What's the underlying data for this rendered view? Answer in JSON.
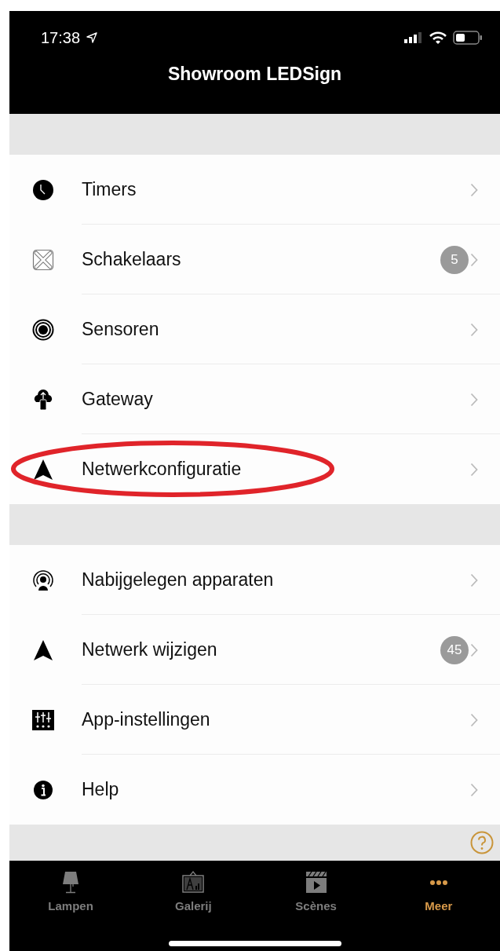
{
  "status_bar": {
    "time": "17:38"
  },
  "header": {
    "title": "Showroom LEDSign"
  },
  "sections": [
    {
      "items": [
        {
          "label": "Timers",
          "annotated": false
        },
        {
          "label": "Schakelaars",
          "badge": "5",
          "annotated": false
        },
        {
          "label": "Sensoren",
          "annotated": false
        },
        {
          "label": "Gateway",
          "annotated": false
        },
        {
          "label": "Netwerkconfiguratie",
          "annotated": true
        }
      ]
    },
    {
      "items": [
        {
          "label": "Nabijgelegen apparaten",
          "annotated": false
        },
        {
          "label": "Netwerk wijzigen",
          "badge": "45",
          "annotated": false
        },
        {
          "label": "App-instellingen",
          "annotated": false
        },
        {
          "label": "Help",
          "annotated": false
        }
      ]
    }
  ],
  "tab_bar": [
    {
      "label": "Lampen",
      "selected": false
    },
    {
      "label": "Galerij",
      "selected": false
    },
    {
      "label": "Scènes",
      "selected": false
    },
    {
      "label": "Meer",
      "selected": true
    }
  ]
}
